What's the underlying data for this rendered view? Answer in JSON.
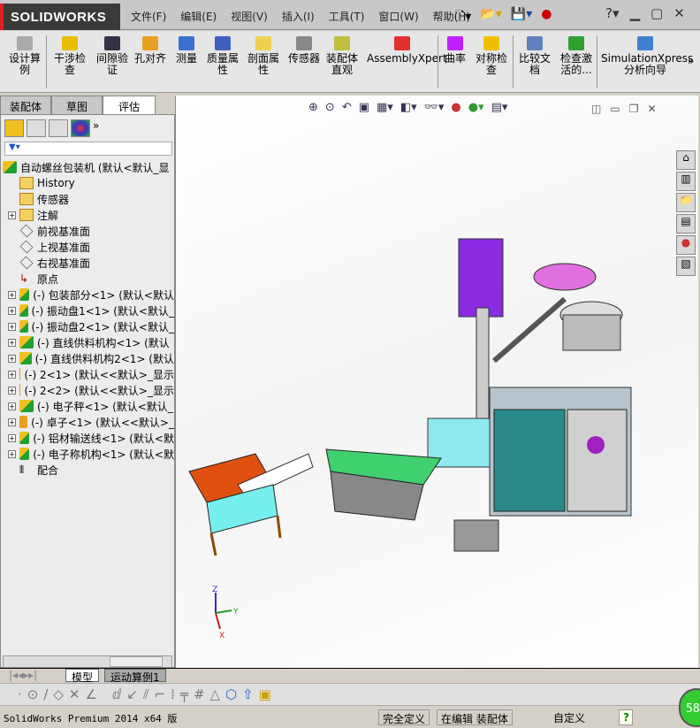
{
  "app": {
    "logo": "SOLIDWORKS"
  },
  "menu": [
    "文件(F)",
    "编辑(E)",
    "视图(V)",
    "插入(I)",
    "工具(T)",
    "窗口(W)",
    "帮助(H)"
  ],
  "ribbon": [
    {
      "label": "设计算例",
      "icon": "design-study-icon"
    },
    {
      "label": "干涉检查",
      "icon": "interference-icon"
    },
    {
      "label": "间隙验证",
      "icon": "clearance-icon"
    },
    {
      "label": "孔对齐",
      "icon": "hole-alignment-icon"
    },
    {
      "label": "测量",
      "icon": "measure-icon"
    },
    {
      "label": "质量属性",
      "icon": "mass-properties-icon"
    },
    {
      "label": "剖面属性",
      "icon": "section-properties-icon"
    },
    {
      "label": "传感器",
      "icon": "sensor-icon"
    },
    {
      "label": "装配体直观",
      "icon": "assembly-visualization-icon"
    },
    {
      "label": "AssemblyXpert",
      "icon": "assemblyxpert-icon"
    },
    {
      "label": "曲率",
      "icon": "curvature-icon"
    },
    {
      "label": "对称检查",
      "icon": "symmetry-check-icon"
    },
    {
      "label": "比较文档",
      "icon": "compare-documents-icon"
    },
    {
      "label": "检查激活的...",
      "icon": "check-active-icon"
    },
    {
      "label": "SimulationXpress分析向导",
      "icon": "simulationxpress-icon"
    }
  ],
  "panel_tabs": [
    "装配体",
    "草图",
    "评估"
  ],
  "tree": [
    {
      "label": "自动螺丝包装机  (默认<默认_显",
      "icon": "asm",
      "pm": false,
      "indent": 0
    },
    {
      "label": "History",
      "icon": "fold",
      "pm": false,
      "indent": 1
    },
    {
      "label": "传感器",
      "icon": "fold",
      "pm": false,
      "indent": 1
    },
    {
      "label": "注解",
      "icon": "fold",
      "pm": true,
      "indent": 1
    },
    {
      "label": "前视基准面",
      "icon": "plane",
      "pm": false,
      "indent": 1
    },
    {
      "label": "上视基准面",
      "icon": "plane",
      "pm": false,
      "indent": 1
    },
    {
      "label": "右视基准面",
      "icon": "plane",
      "pm": false,
      "indent": 1
    },
    {
      "label": "原点",
      "icon": "origin",
      "pm": false,
      "indent": 1
    },
    {
      "label": "(-) 包装部分<1> (默认<默认",
      "icon": "asm",
      "pm": true,
      "indent": 1
    },
    {
      "label": "(-) 振动盘1<1> (默认<默认_",
      "icon": "asm",
      "pm": true,
      "indent": 1
    },
    {
      "label": "(-) 振动盘2<1> (默认<默认_",
      "icon": "asm",
      "pm": true,
      "indent": 1
    },
    {
      "label": "(-) 直线供料机构<1> (默认",
      "icon": "asm",
      "pm": true,
      "indent": 1
    },
    {
      "label": "(-) 直线供料机构2<1> (默认",
      "icon": "asm",
      "pm": true,
      "indent": 1
    },
    {
      "label": "(-) 2<1> (默认<<默认>_显示",
      "icon": "part",
      "pm": true,
      "indent": 1
    },
    {
      "label": "(-) 2<2> (默认<<默认>_显示",
      "icon": "part",
      "pm": true,
      "indent": 1
    },
    {
      "label": "(-) 电子秤<1> (默认<默认_",
      "icon": "asm",
      "pm": true,
      "indent": 1
    },
    {
      "label": "(-) 卓子<1> (默认<<默认>_",
      "icon": "part",
      "pm": true,
      "indent": 1
    },
    {
      "label": "(-) 铝材输送线<1> (默认<默",
      "icon": "asm",
      "pm": true,
      "indent": 1
    },
    {
      "label": "(-) 电子称机构<1> (默认<默",
      "icon": "asm",
      "pm": true,
      "indent": 1
    },
    {
      "label": "配合",
      "icon": "mates",
      "pm": false,
      "indent": 1
    }
  ],
  "bottom_tabs": [
    "模型",
    "运动算例1"
  ],
  "status": {
    "product": "SolidWorks Premium 2014 x64 版",
    "defined": "完全定义",
    "editing": "在编辑 装配体",
    "units": "自定义",
    "badge": "58"
  },
  "axes": {
    "x": "X",
    "y": "Y",
    "z": "Z"
  }
}
